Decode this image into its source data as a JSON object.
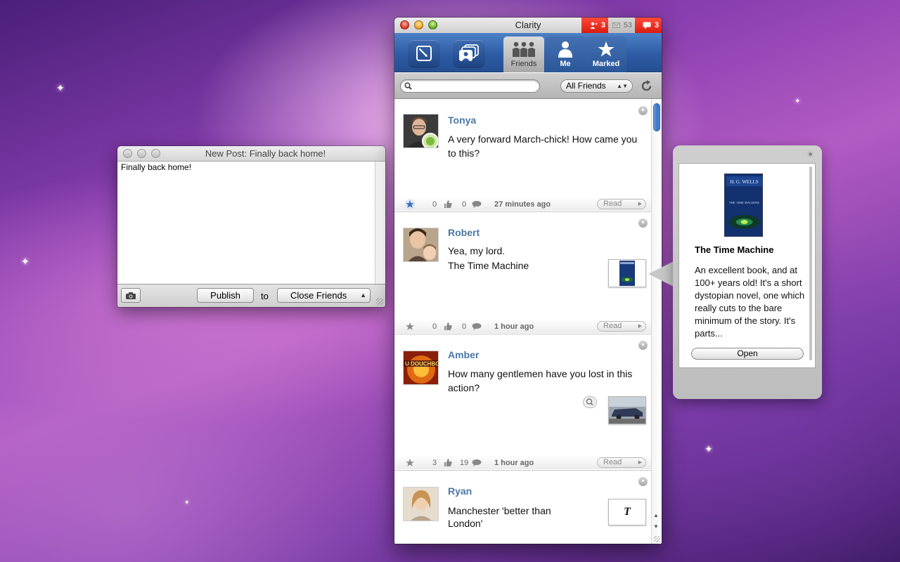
{
  "new_post": {
    "title": "New Post: Finally back home!",
    "content": "Finally back home!",
    "publish_label": "Publish",
    "to_label": "to",
    "audience": "Close Friends"
  },
  "clarity": {
    "title": "Clarity",
    "notifications": [
      {
        "icon": "friend-request-icon",
        "count": "3",
        "color": "#e8261a"
      },
      {
        "icon": "mail-icon",
        "count": "53",
        "color": "#c8c8c8"
      },
      {
        "icon": "chat-icon",
        "count": "3",
        "color": "#e8261a"
      }
    ],
    "tabs": [
      {
        "label": "Friends",
        "icon": "friends-icon",
        "active": true
      },
      {
        "label": "Me",
        "icon": "person-icon",
        "active": false
      },
      {
        "label": "Marked",
        "icon": "star-icon",
        "active": false
      }
    ],
    "search_placeholder": "",
    "filter": "All Friends",
    "posts": [
      {
        "name": "Tonya",
        "lines": [
          "A very forward March-chick! How came you",
          "to this?"
        ],
        "likes": "0",
        "comments": "0",
        "time": "27 minutes ago",
        "read_label": "Read",
        "starred": true
      },
      {
        "name": "Robert",
        "lines": [
          "Yea, my lord.",
          "The Time Machine"
        ],
        "likes": "0",
        "comments": "0",
        "time": "1 hour ago",
        "read_label": "Read",
        "starred": false
      },
      {
        "name": "Amber",
        "lines": [
          "How many gentlemen have you lost in this",
          "action?"
        ],
        "likes": "3",
        "comments": "19",
        "time": "1 hour ago",
        "read_label": "Read",
        "starred": false
      },
      {
        "name": "Ryan",
        "lines": [
          "Manchester 'better than",
          "London'"
        ],
        "thumb_text": "T"
      }
    ]
  },
  "popover": {
    "cover_author": "H. G. WELLS",
    "cover_title": "THE TIME MACHINE",
    "title": "The Time Machine",
    "description": "An excellent book, and at 100+ years old! It's a short dystopian novel, one which really cuts to the bare minimum of the story. It's parts...",
    "open_label": "Open"
  }
}
